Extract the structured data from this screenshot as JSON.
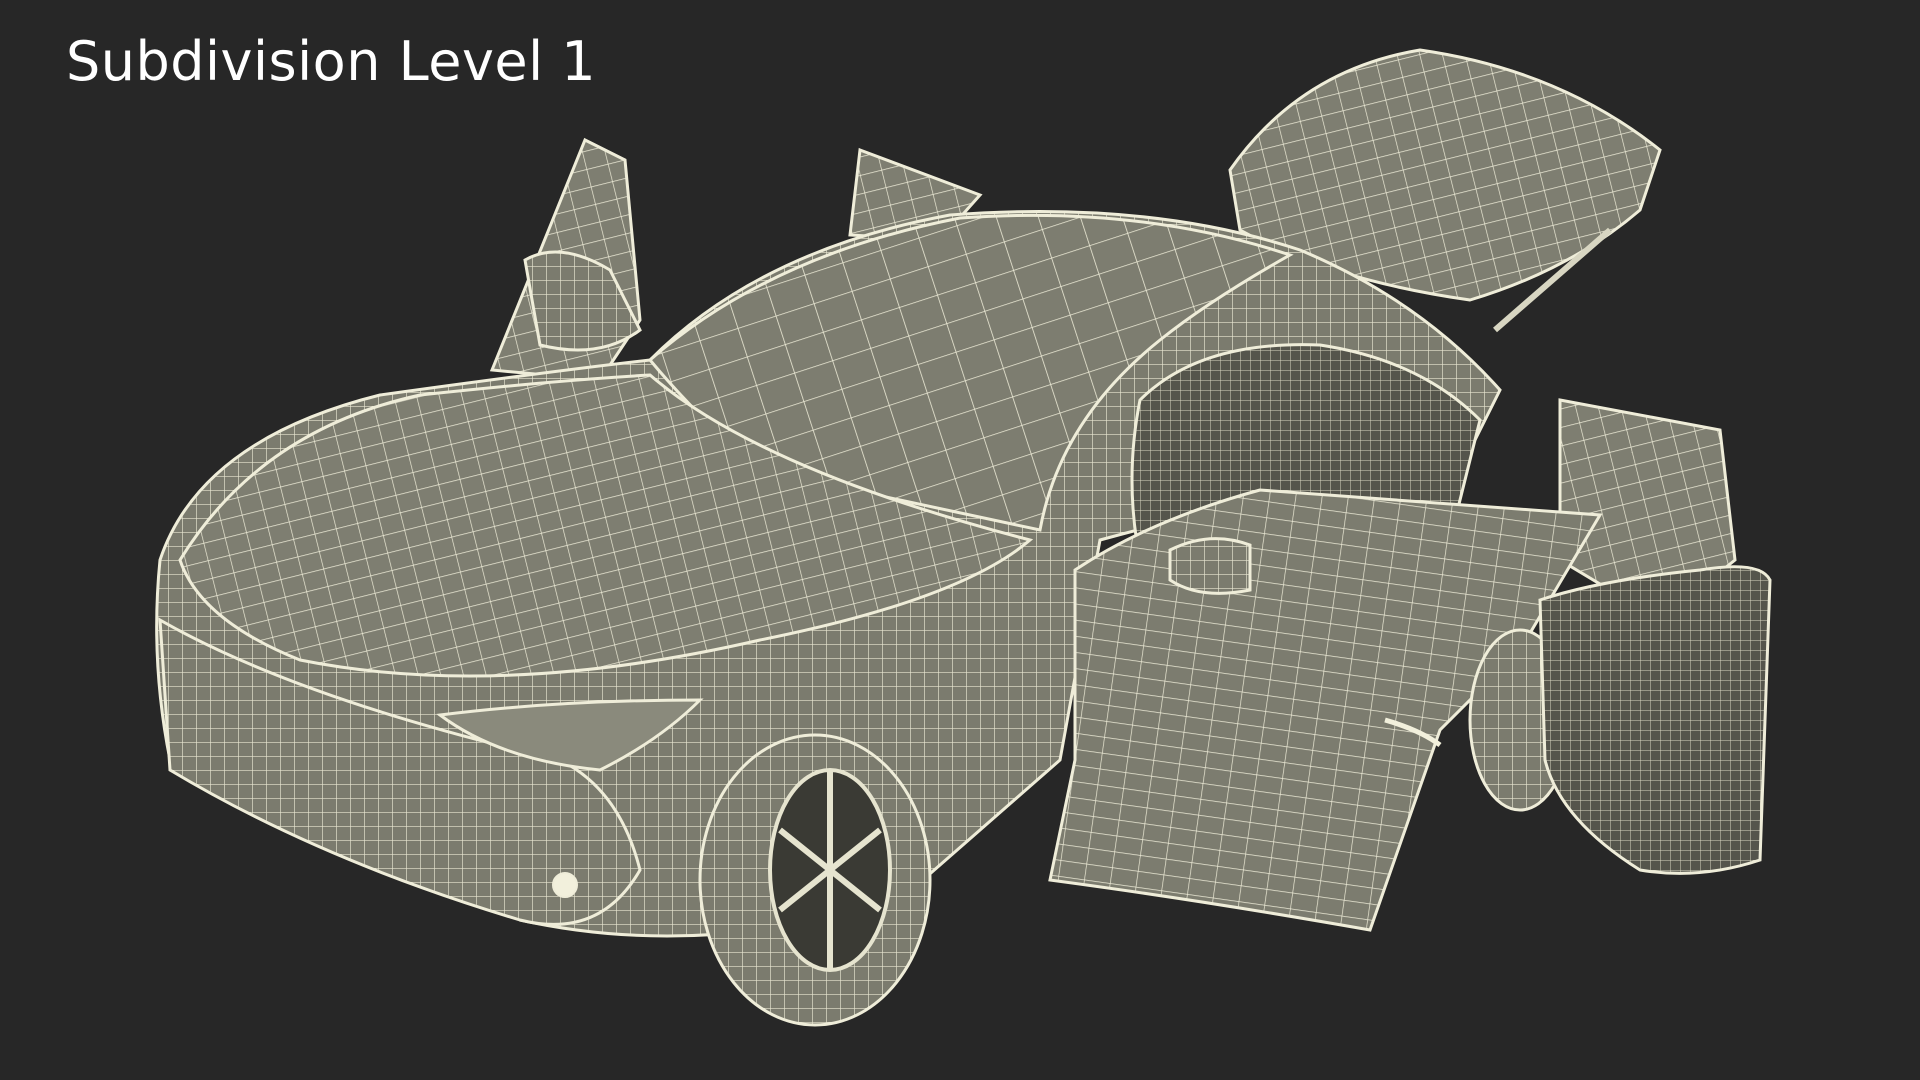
{
  "title": "Subdivision Level 1",
  "colors": {
    "background": "#272727",
    "wire": "#e6e4cf",
    "surface": "#7a7a6d",
    "surface_dark": "#5f5f55",
    "title_text": "#ffffff"
  }
}
